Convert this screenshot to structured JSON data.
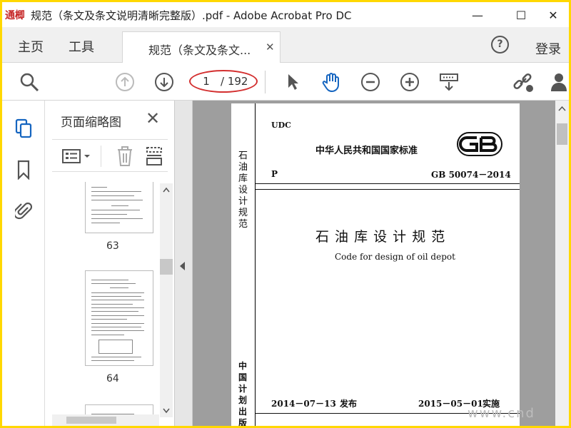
{
  "window": {
    "app_icon_text": "通楖",
    "title": "规范（条文及条文说明清晰完整版）.pdf - Adobe Acrobat Pro DC",
    "minimize": "—",
    "maximize": "☐",
    "close": "✕"
  },
  "tabs": {
    "home": "主页",
    "tools": "工具",
    "document": "规范（条文及条文...",
    "document_close": "✕",
    "help": "?",
    "login": "登录"
  },
  "toolbar": {
    "page_current": "1",
    "page_total": "/ 192"
  },
  "thumbnails": {
    "title": "页面缩略图",
    "close": "✕",
    "items": [
      {
        "label": "63"
      },
      {
        "label": "64"
      }
    ]
  },
  "document": {
    "spine_top": "石油库设计规范",
    "spine_bottom": "中国计划出版",
    "udc": "UDC",
    "national_standard": "中华人民共和国国家标准",
    "category": "P",
    "code": "GB 50074－2014",
    "title_cn": "石 油 库 设 计 规 范",
    "title_en": "Code for design of oil depot",
    "issue_date": "2014－07－13",
    "issue_label": "发布",
    "effective_date": "2015－05－01",
    "effective_label": "实施"
  },
  "watermark": "www.cnd",
  "colors": {
    "frame": "#ffd800",
    "annotation": "#d32f2f",
    "doc_bg": "#9e9e9e"
  }
}
